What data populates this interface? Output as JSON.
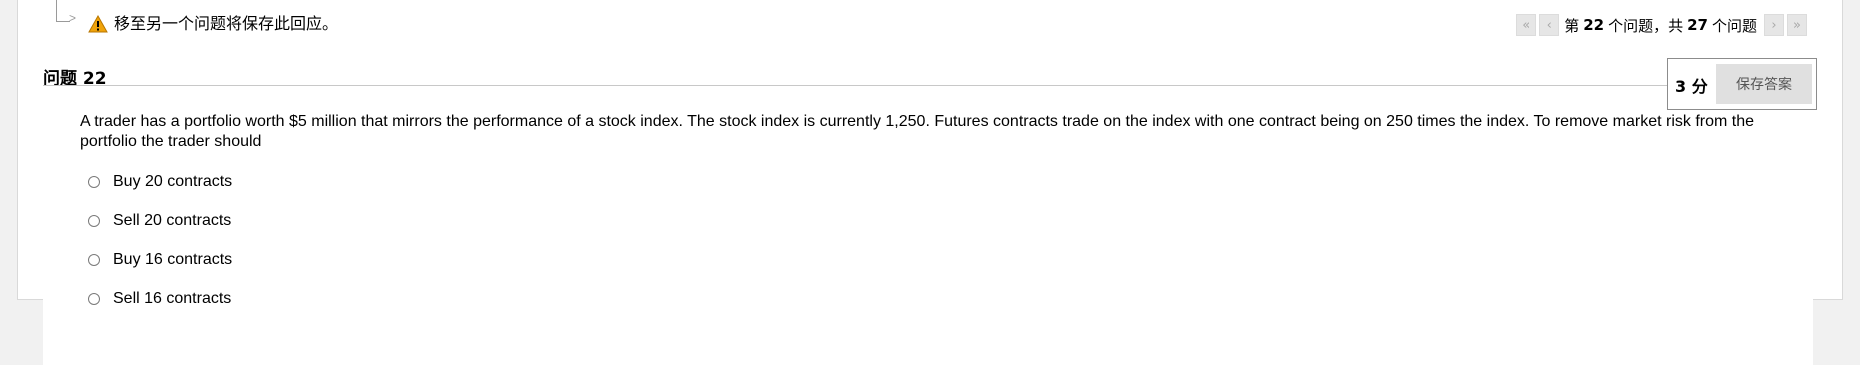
{
  "warning": {
    "icon": "warning-icon",
    "text": "移至另一个问题将保存此回应。"
  },
  "navigation": {
    "first_icon": "«",
    "prev_icon": "‹",
    "next_icon": "›",
    "last_icon": "»",
    "prefix": "第",
    "current": "22",
    "middle": "个问题，共",
    "total": "27",
    "suffix": "个问题"
  },
  "question": {
    "title": "问题 22",
    "points": "3 分",
    "save_label": "保存答案",
    "text": "A trader has a portfolio worth $5 million that mirrors the performance of a stock index. The stock index is currently 1,250. Futures contracts trade on the index with one contract being on 250 times the index. To remove market risk from the portfolio the trader should",
    "options": [
      {
        "label": "Buy 20 contracts",
        "selected": false
      },
      {
        "label": "Sell 20 contracts",
        "selected": false
      },
      {
        "label": "Buy 16 contracts",
        "selected": false
      },
      {
        "label": "Sell 16 contracts",
        "selected": false
      }
    ]
  },
  "colors": {
    "warning_fill": "#f0a30a",
    "nav_button_bg": "#e6e6e6",
    "save_button_bg": "#e0e0e0",
    "page_bg": "#f1f1f1"
  }
}
